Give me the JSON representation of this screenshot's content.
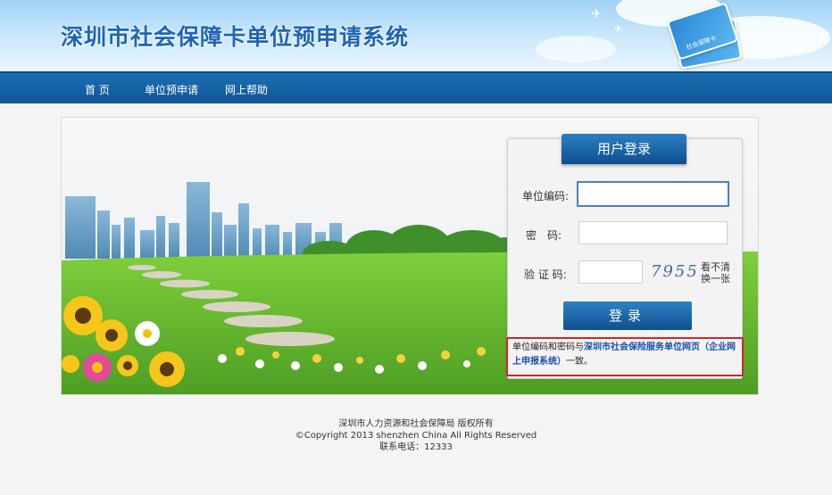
{
  "header": {
    "title": "深圳市社会保障卡单位预申请系统",
    "card_label": "社会保障卡"
  },
  "nav": {
    "items": [
      "首 页",
      "单位预申请",
      "网上帮助"
    ]
  },
  "login": {
    "title": "用户登录",
    "unit_code_label": "单位编码:",
    "password_label": "密　码:",
    "captcha_label": "验 证 码:",
    "captcha_value": "7955",
    "refresh_line1": "看不清",
    "refresh_line2": "换一张",
    "submit_label": "登录",
    "unit_code_value": "",
    "password_value": "",
    "captcha_input_value": "",
    "notice_prefix": "单位编码和密码与",
    "notice_link": "深圳市社会保险服务单位网页（企业网上申报系统）",
    "notice_suffix": "一致。"
  },
  "footer": {
    "line1": "深圳市人力资源和社会保障局 版权所有",
    "line2": "©Copyright 2013 shenzhen China All Rights Reserved",
    "line3": "联系电话：12333"
  },
  "colors": {
    "brand_blue": "#1f65b5",
    "nav_blue": "#0f5697",
    "notice_border": "#d9222a",
    "grass": "#6fc23a",
    "sky": "#eaf6fe"
  }
}
